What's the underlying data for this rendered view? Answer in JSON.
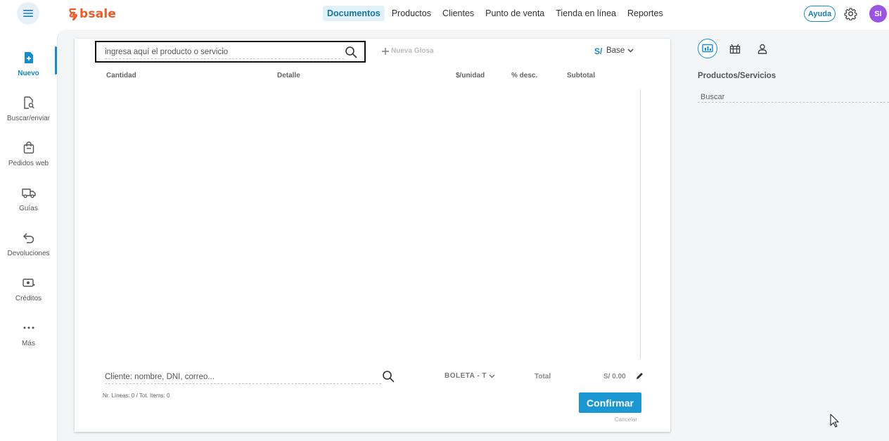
{
  "app": {
    "logo_text": "bsale",
    "brand_color": "#f05a28",
    "accent_color": "#1a8ccc"
  },
  "topnav": {
    "items": [
      {
        "label": "Documentos",
        "active": true
      },
      {
        "label": "Productos"
      },
      {
        "label": "Clientes"
      },
      {
        "label": "Punto de venta"
      },
      {
        "label": "Tienda en línea"
      },
      {
        "label": "Reportes"
      }
    ],
    "help_label": "Ayuda",
    "avatar_initials": "SI"
  },
  "sidebar": {
    "items": [
      {
        "label": "Nuevo",
        "icon": "new-document-icon",
        "active": true
      },
      {
        "label": "Buscar/enviar",
        "icon": "document-search-icon"
      },
      {
        "label": "Pedidos web",
        "icon": "shopping-bag-icon"
      },
      {
        "label": "Guías",
        "icon": "truck-icon"
      },
      {
        "label": "Devoluciones",
        "icon": "return-arrow-icon"
      },
      {
        "label": "Créditos",
        "icon": "cash-icon"
      },
      {
        "label": "Más",
        "icon": "more-dots-icon"
      }
    ]
  },
  "document": {
    "search_placeholder": "ingresa aquí el producto o servicio",
    "new_glosa_label": "Nueva Glosa",
    "currency": "S/",
    "price_list": "Base",
    "columns": [
      "Cantidad",
      "Detalle",
      "$/unidad",
      "% desc.",
      "Subtotal"
    ],
    "rows": [],
    "client_placeholder": "Cliente: nombre, DNI, correo...",
    "doc_type": "BOLETA - T",
    "total_label": "Total",
    "total_value": "S/ 0.00",
    "counts": "Nr. Líneas: 0 / Tot. Items: 0",
    "confirm_label": "Confirmar",
    "cancel_label": "Cancelar"
  },
  "right_panel": {
    "tabs": [
      "products-tab-icon",
      "gift-icon",
      "user-icon"
    ],
    "title": "Productos/Servicios",
    "search_placeholder": "Buscar"
  }
}
